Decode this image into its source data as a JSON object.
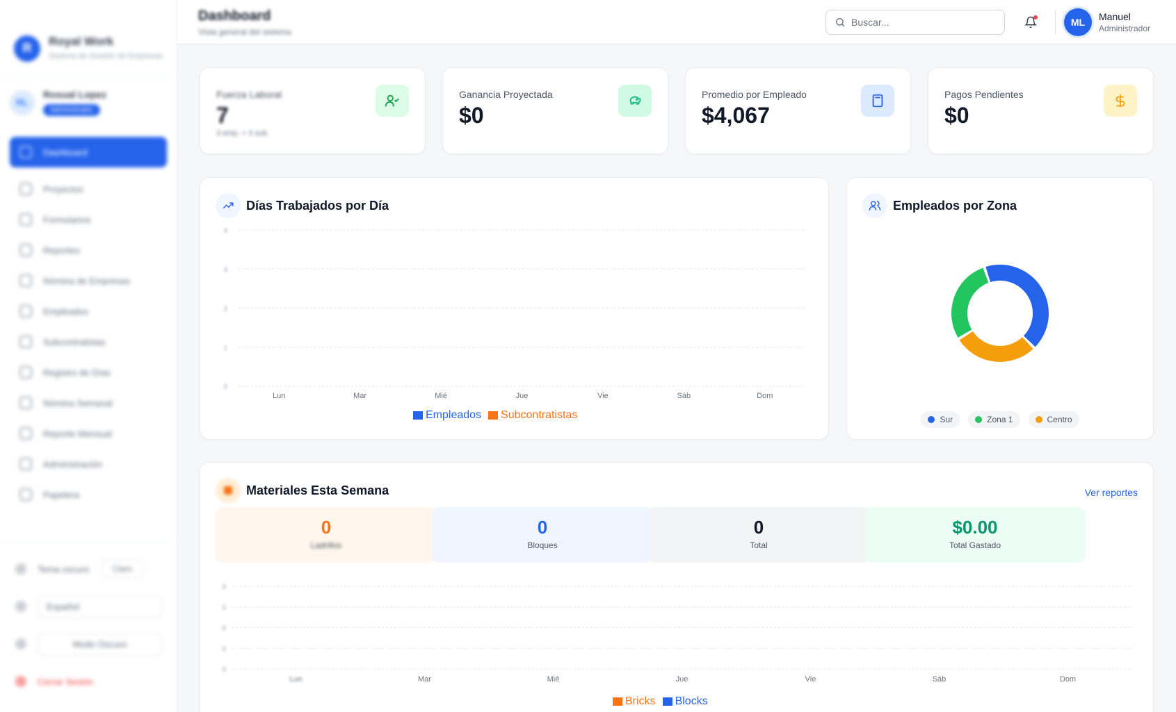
{
  "sidebar": {
    "brand_name": "Royal Work",
    "brand_sub": "Sistema de Gestión de Empresas",
    "user_initials": "RL",
    "user_name": "Rosual Lopez",
    "user_role": "Administrador",
    "items": [
      {
        "label": "Dashboard",
        "icon": "grid-icon"
      },
      {
        "label": "Proyectos",
        "icon": "folder-icon"
      },
      {
        "label": "Formularios",
        "icon": "form-icon"
      },
      {
        "label": "Reportes",
        "icon": "chart-icon"
      },
      {
        "label": "Nómina de Empresas",
        "icon": "payroll-icon"
      },
      {
        "label": "Empleados",
        "icon": "users-icon"
      },
      {
        "label": "Subcontratistas",
        "icon": "team-icon"
      },
      {
        "label": "Registro de Días",
        "icon": "clock-icon"
      },
      {
        "label": "Nómina Semanal",
        "icon": "money-icon"
      },
      {
        "label": "Reporte Mensual",
        "icon": "calendar-icon"
      },
      {
        "label": "Administración",
        "icon": "settings-icon"
      },
      {
        "label": "Papelera",
        "icon": "trash-icon"
      }
    ],
    "bottom": {
      "theme_label": "Tema oscuro",
      "theme_value": "Claro",
      "language_label": "Español",
      "mode_label": "Modo Oscuro",
      "logout_label": "Cerrar Sesión"
    }
  },
  "header": {
    "title": "Dashboard",
    "subtitle": "Vista general del sistema",
    "search_placeholder": "Buscar...",
    "user_initials": "ML",
    "user_name": "Manuel",
    "user_role": "Administrador",
    "accent": "#2563eb"
  },
  "stats": [
    {
      "label": "Fuerza Laboral",
      "value": "7",
      "sub": "3 emp. + 3 sub.",
      "icon": "user-check-icon",
      "icon_bg": "#dcfce7",
      "icon_color": "#16a34a"
    },
    {
      "label": "Ganancia Proyectada",
      "value": "$0",
      "sub": "",
      "icon": "piggy-bank-icon",
      "icon_bg": "#d1fae5",
      "icon_color": "#10b981"
    },
    {
      "label": "Promedio por Empleado",
      "value": "$4,067",
      "sub": "",
      "icon": "calculator-icon",
      "icon_bg": "#dbeafe",
      "icon_color": "#2563eb"
    },
    {
      "label": "Pagos Pendientes",
      "value": "$0",
      "sub": "",
      "icon": "dollar-icon",
      "icon_bg": "#fef3c7",
      "icon_color": "#f59e0b"
    }
  ],
  "days_chart": {
    "title": "Días Trabajados por Día",
    "icon": "trending-up-icon"
  },
  "zone_chart": {
    "title": "Empleados por Zona",
    "icon": "users-icon"
  },
  "materials": {
    "title": "Materiales Esta Semana",
    "icon": "box-icon",
    "link": "Ver reportes",
    "boxes": [
      {
        "value": "0",
        "label": "Ladrillos",
        "bg": "#fff7ed",
        "color": "#f97316"
      },
      {
        "value": "0",
        "label": "Bloques",
        "bg": "#eff6ff",
        "color": "#2563eb"
      },
      {
        "value": "0",
        "label": "Total",
        "bg": "#f3f4f6",
        "color": "#111827"
      },
      {
        "value": "$0.00",
        "label": "Total Gastado",
        "bg": "#ecfdf5",
        "color": "#059669"
      }
    ]
  },
  "chart_data": [
    {
      "type": "bar",
      "title": "Días Trabajados por Día",
      "categories": [
        "Lun",
        "Mar",
        "Mié",
        "Jue",
        "Vie",
        "Sáb",
        "Dom"
      ],
      "yticks": [
        "0",
        "1",
        "2",
        "3",
        "4"
      ],
      "ylim": [
        0,
        4
      ],
      "series": [
        {
          "name": "Empleados",
          "color": "#2563eb",
          "values": [
            0,
            0,
            0,
            0,
            0,
            0,
            0
          ]
        },
        {
          "name": "Subcontratistas",
          "color": "#f97316",
          "values": [
            0,
            0,
            0,
            0,
            0,
            0,
            0
          ]
        }
      ],
      "grid": true,
      "legend": "bottom"
    },
    {
      "type": "pie",
      "title": "Empleados por Zona",
      "donut": true,
      "slices": [
        {
          "name": "Sur",
          "value": 3,
          "color": "#2563eb"
        },
        {
          "name": "Centro",
          "value": 2,
          "color": "#f59e0b"
        },
        {
          "name": "Zona 1",
          "value": 2,
          "color": "#22c55e"
        }
      ],
      "legend": "bottom"
    },
    {
      "type": "bar",
      "title": "Materiales Esta Semana",
      "categories": [
        "Lun",
        "Mar",
        "Mié",
        "Jue",
        "Vie",
        "Sáb",
        "Dom"
      ],
      "yticks": [
        "0",
        "0",
        "0",
        "0",
        "0"
      ],
      "series": [
        {
          "name": "Bricks",
          "color": "#f97316",
          "values": [
            0,
            0,
            0,
            0,
            0,
            0,
            0
          ]
        },
        {
          "name": "Blocks",
          "color": "#2563eb",
          "values": [
            0,
            0,
            0,
            0,
            0,
            0,
            0
          ]
        }
      ],
      "grid": true,
      "legend": "bottom"
    }
  ]
}
